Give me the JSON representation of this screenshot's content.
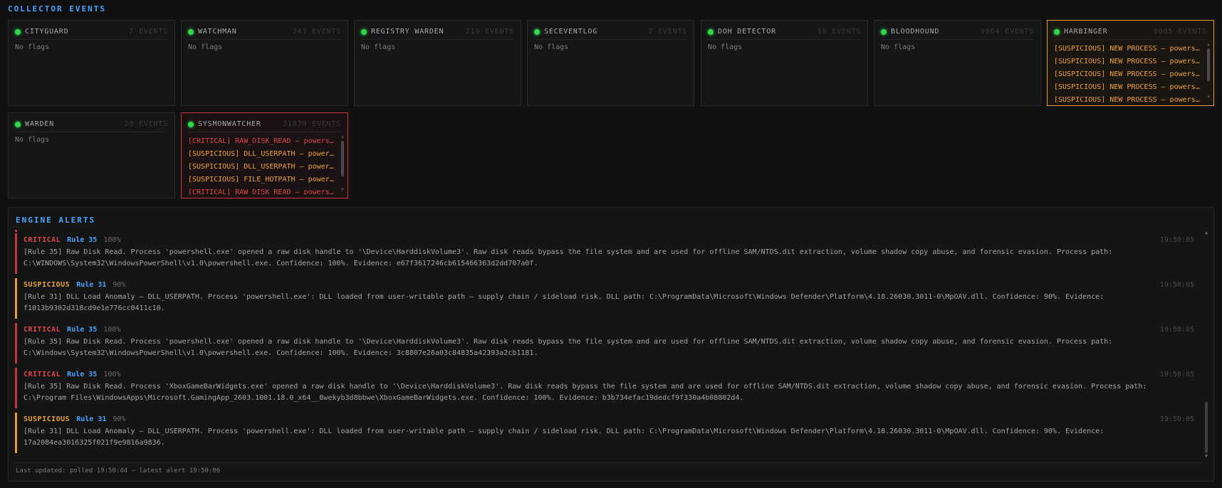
{
  "collector": {
    "title": "COLLECTOR EVENTS",
    "cards": [
      {
        "name": "CITYGUARD",
        "count": "7 EVENTS",
        "empty_text": "No flags",
        "flags": []
      },
      {
        "name": "WATCHMAN",
        "count": "243 EVENTS",
        "empty_text": "No flags",
        "flags": []
      },
      {
        "name": "REGISTRY WARDEN",
        "count": "219 EVENTS",
        "empty_text": "No flags",
        "flags": []
      },
      {
        "name": "SECEVENTLOG",
        "count": "2 EVENTS",
        "empty_text": "No flags",
        "flags": []
      },
      {
        "name": "DOH DETECTOR",
        "count": "10 EVENTS",
        "empty_text": "No flags",
        "flags": []
      },
      {
        "name": "BLOODHOUND",
        "count": "9064 EVENTS",
        "empty_text": "No flags",
        "flags": []
      },
      {
        "name": "HARBINGER",
        "count": "8005 EVENTS",
        "empty_text": "",
        "flags": [
          "[SUSPICIOUS] NEW PROCESS — powershell.exe",
          "[SUSPICIOUS] NEW PROCESS — powershell.exe",
          "[SUSPICIOUS] NEW PROCESS — powershell.exe",
          "[SUSPICIOUS] NEW PROCESS — powershell.exe",
          "[SUSPICIOUS] NEW PROCESS — powershell.exe"
        ]
      },
      {
        "name": "WARDEN",
        "count": "29 EVENTS",
        "empty_text": "No flags",
        "flags": []
      },
      {
        "name": "SYSMONWATCHER",
        "count": "21079 EVENTS",
        "empty_text": "",
        "flags": [
          "[CRITICAL] RAW_DISK_READ — powershell.exe",
          "[SUSPICIOUS] DLL_USERPATH — powershell.exe",
          "[SUSPICIOUS] DLL_USERPATH — powershell.exe",
          "[SUSPICIOUS] FILE_HOTPATH — powershell.exe",
          "[CRITICAL] RAW_DISK_READ — powershell.exe"
        ]
      }
    ]
  },
  "engine": {
    "title": "ENGINE ALERTS",
    "alerts": [
      {
        "severity": "CRITICAL",
        "rule": "Rule 35",
        "confidence": "100%",
        "time": "19:50:05",
        "message": "[Rule 35] Raw Disk Read. Process 'powershell.exe' opened a raw disk handle to '\\Device\\HarddiskVolume3'. Raw disk reads bypass the file system and are used for offline SAM/NTDS.dit extraction, volume shadow copy abuse, and forensic evasion. Process path:\nC:\\WINDOWS\\System32\\WindowsPowerShell\\v1.0\\powershell.exe. Confidence: 100%. Evidence: e67f3617246cb615466363d2dd707a0f."
      },
      {
        "severity": "SUSPICIOUS",
        "rule": "Rule 31",
        "confidence": "90%",
        "time": "19:50:05",
        "message": "[Rule 31] DLL Load Anomaly — DLL_USERPATH. Process 'powershell.exe': DLL loaded from user-writable path — supply chain / sideload risk. DLL path: C:\\ProgramData\\Microsoft\\Windows Defender\\Platform\\4.18.26030.3011-0\\MpOAV.dll. Confidence: 90%. Evidence:\nf1013b9302d318cd9e1e776cc0411c10."
      },
      {
        "severity": "CRITICAL",
        "rule": "Rule 35",
        "confidence": "100%",
        "time": "19:50:05",
        "message": "[Rule 35] Raw Disk Read. Process 'powershell.exe' opened a raw disk handle to '\\Device\\HarddiskVolume3'. Raw disk reads bypass the file system and are used for offline SAM/NTDS.dit extraction, volume shadow copy abuse, and forensic evasion. Process path:\nC:\\Windows\\System32\\WindowsPowerShell\\v1.0\\powershell.exe. Confidence: 100%. Evidence: 3c8807e26a03c84835a42393a2cb1181."
      },
      {
        "severity": "CRITICAL",
        "rule": "Rule 35",
        "confidence": "100%",
        "time": "19:50:05",
        "message": "[Rule 35] Raw Disk Read. Process 'XboxGameBarWidgets.exe' opened a raw disk handle to '\\Device\\HarddiskVolume3'. Raw disk reads bypass the file system and are used for offline SAM/NTDS.dit extraction, volume shadow copy abuse, and forensic evasion. Process path:\nC:\\Program Files\\WindowsApps\\Microsoft.GamingApp_2603.1001.18.0_x64__8wekyb3d8bbwe\\XboxGameBarWidgets.exe. Confidence: 100%. Evidence: b3b734efac19dedcf9f330a4b08802d4."
      },
      {
        "severity": "SUSPICIOUS",
        "rule": "Rule 31",
        "confidence": "90%",
        "time": "19:50:05",
        "message": "[Rule 31] DLL Load Anomaly — DLL_USERPATH. Process 'powershell.exe': DLL loaded from user-writable path — supply chain / sideload risk. DLL path: C:\\ProgramData\\Microsoft\\Windows Defender\\Platform\\4.18.26030.3011-0\\MpOAV.dll. Confidence: 90%. Evidence:\n17a2084ea3016325f021f9e9816a9836."
      }
    ],
    "footer": "Last updated: polled 19:50:44 — latest alert 19:50:06"
  }
}
